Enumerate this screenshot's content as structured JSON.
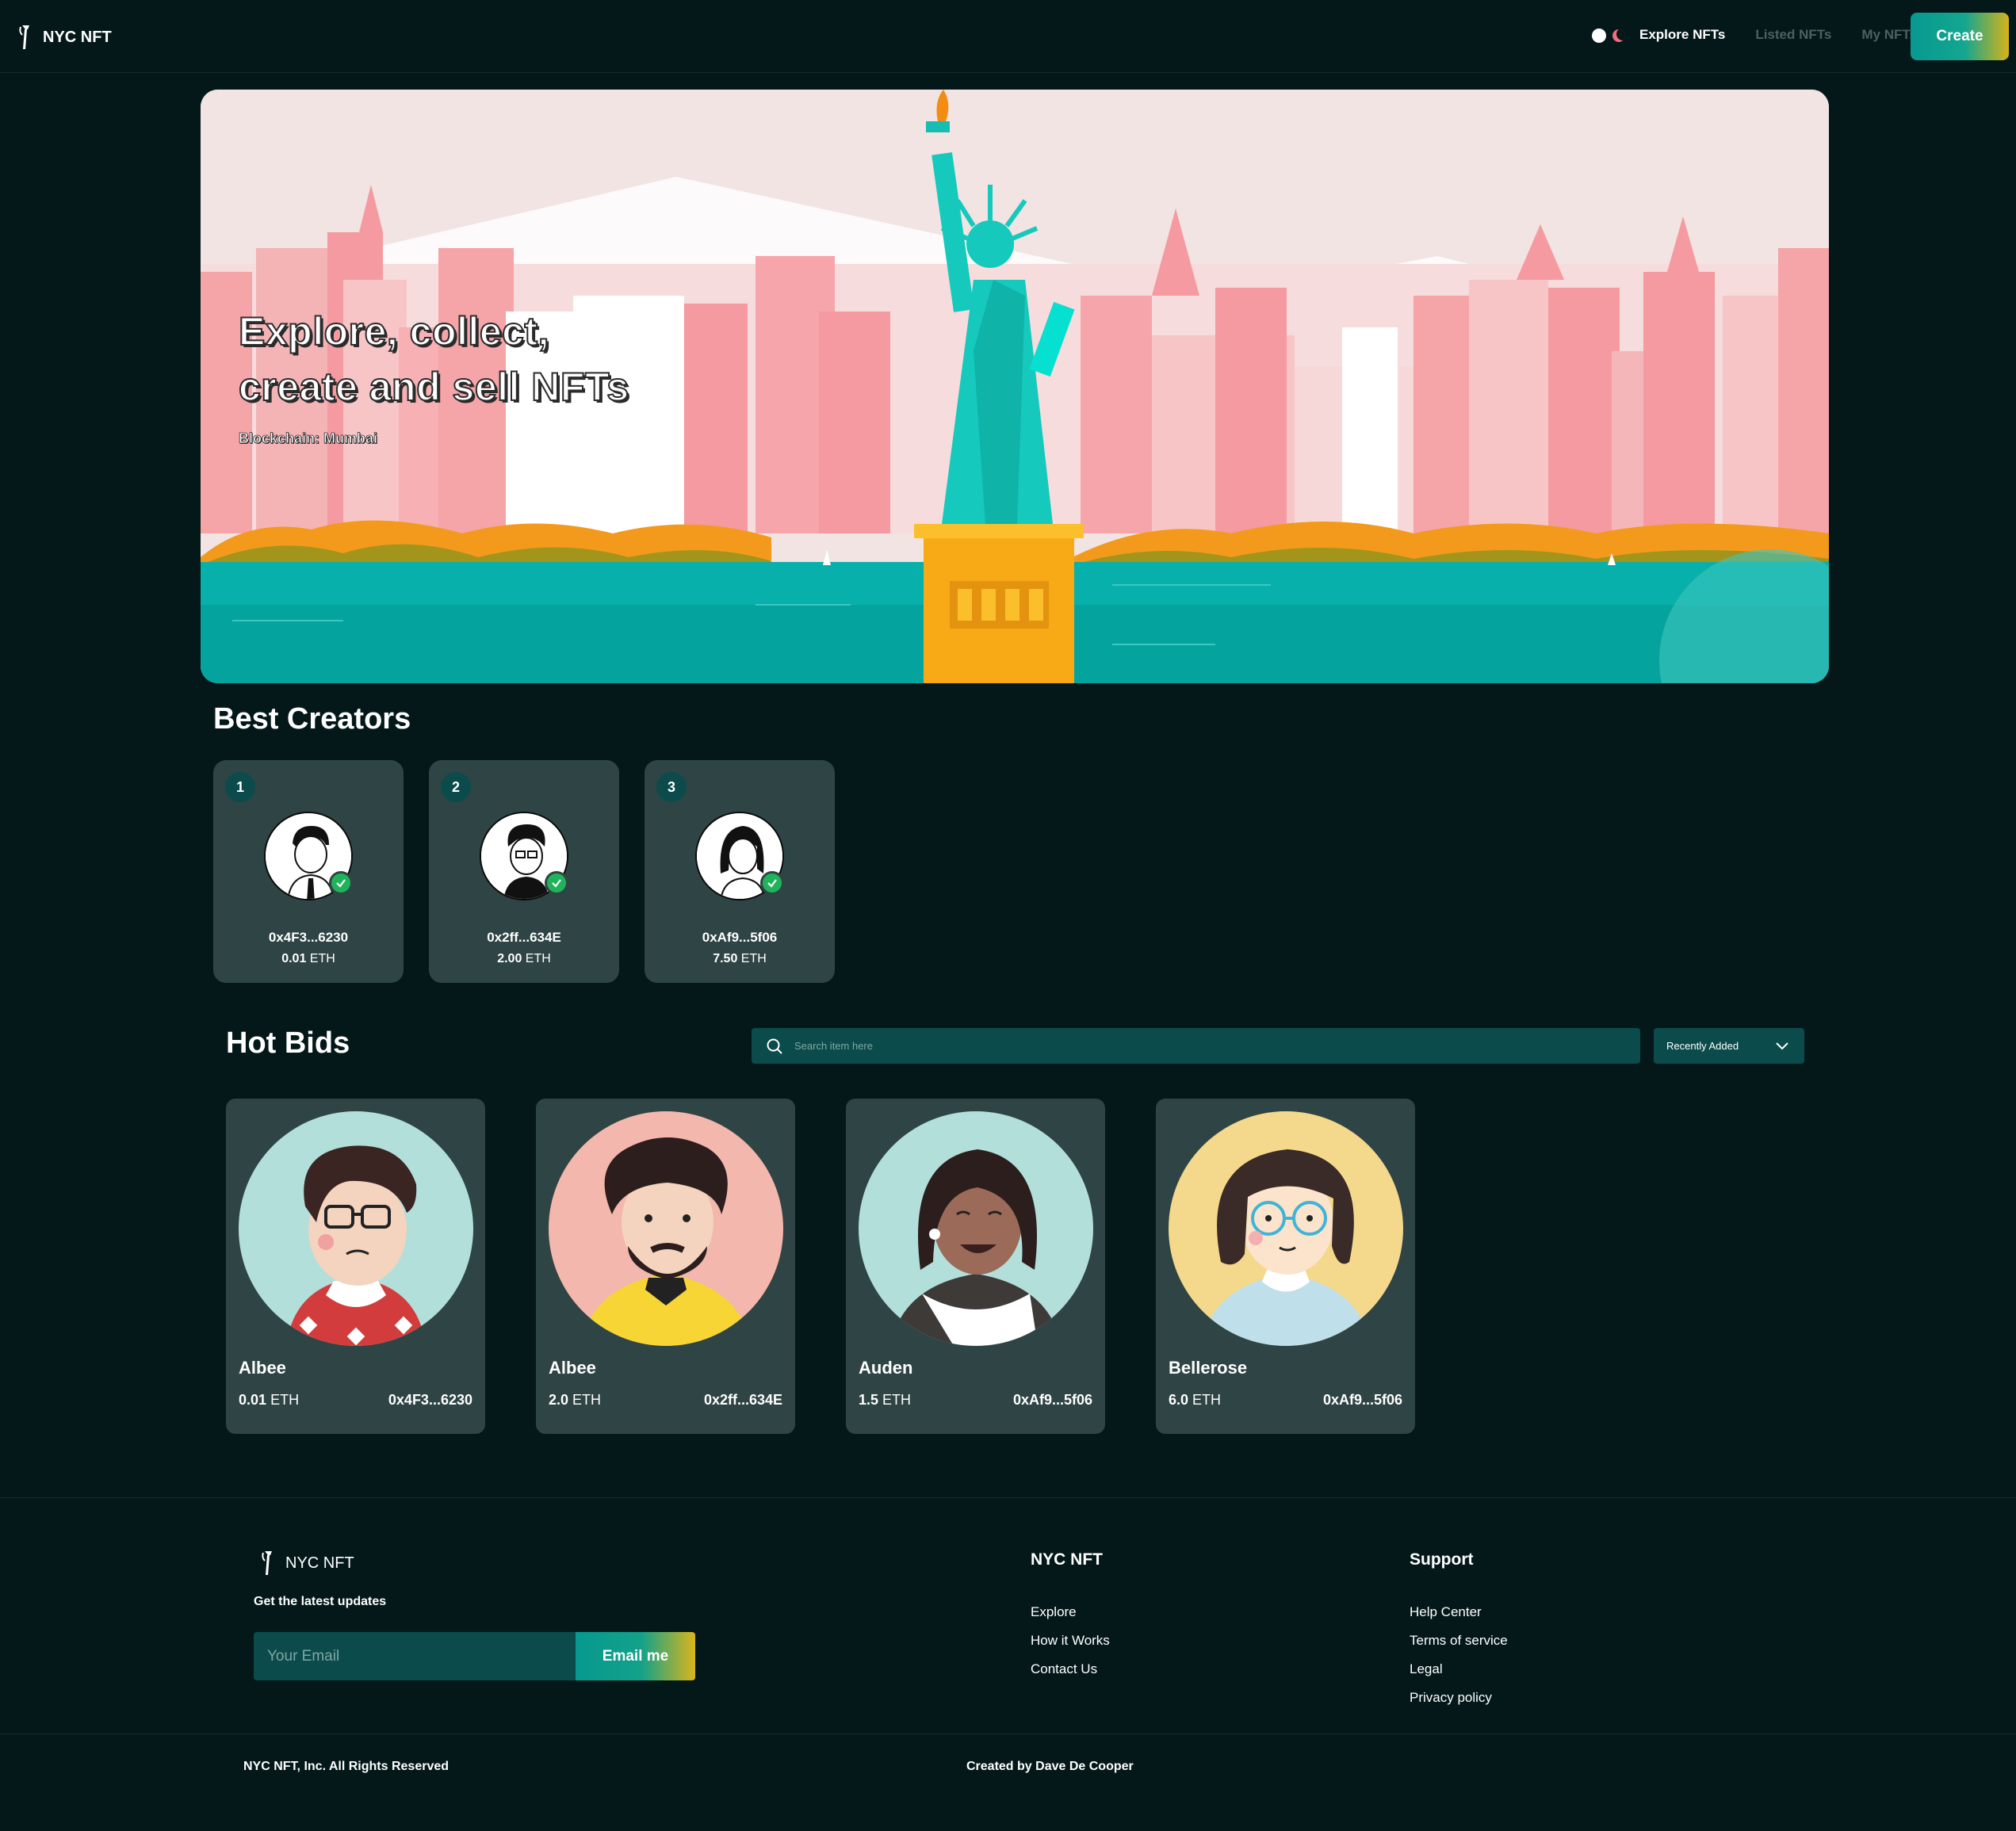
{
  "nav": {
    "brand": "NYC NFT",
    "links": [
      "Explore NFTs",
      "Listed NFTs",
      "My NFTs"
    ],
    "create_label": "Create"
  },
  "hero": {
    "title_line1": "Explore, collect,",
    "title_line2": "create and sell NFTs",
    "subtitle": "Blockchain: Mumbai"
  },
  "creators": {
    "title": "Best Creators",
    "items": [
      {
        "rank": "1",
        "address": "0x4F3...6230",
        "amount": "0.01",
        "unit": "ETH"
      },
      {
        "rank": "2",
        "address": "0x2ff...634E",
        "amount": "2.00",
        "unit": "ETH"
      },
      {
        "rank": "3",
        "address": "0xAf9...5f06",
        "amount": "7.50",
        "unit": "ETH"
      }
    ]
  },
  "hot_bids": {
    "title": "Hot Bids",
    "search_placeholder": "Search item here",
    "sort_selected": "Recently Added",
    "items": [
      {
        "name": "Albee",
        "price": "0.01",
        "unit": "ETH",
        "owner": "0x4F3...6230"
      },
      {
        "name": "Albee",
        "price": "2.0",
        "unit": "ETH",
        "owner": "0x2ff...634E"
      },
      {
        "name": "Auden",
        "price": "1.5",
        "unit": "ETH",
        "owner": "0xAf9...5f06"
      },
      {
        "name": "Bellerose",
        "price": "6.0",
        "unit": "ETH",
        "owner": "0xAf9...5f06"
      }
    ]
  },
  "footer": {
    "brand": "NYC NFT",
    "tagline": "Get the latest updates",
    "email_placeholder": "Your Email",
    "email_button": "Email me",
    "col1_title": "NYC NFT",
    "col1_links": [
      "Explore",
      "How it Works",
      "Contact Us"
    ],
    "col2_title": "Support",
    "col2_links": [
      "Help Center",
      "Terms of service",
      "Legal",
      "Privacy policy"
    ],
    "copyright": "NYC NFT, Inc. All Rights Reserved",
    "credit": "Created by Dave De Cooper"
  },
  "colors": {
    "background": "#04181a",
    "card": "#2f4444",
    "accent_teal": "#0b4b4b",
    "gradient_start": "#07998f",
    "gradient_end": "#d6b21a",
    "verified_green": "#21b35b"
  }
}
